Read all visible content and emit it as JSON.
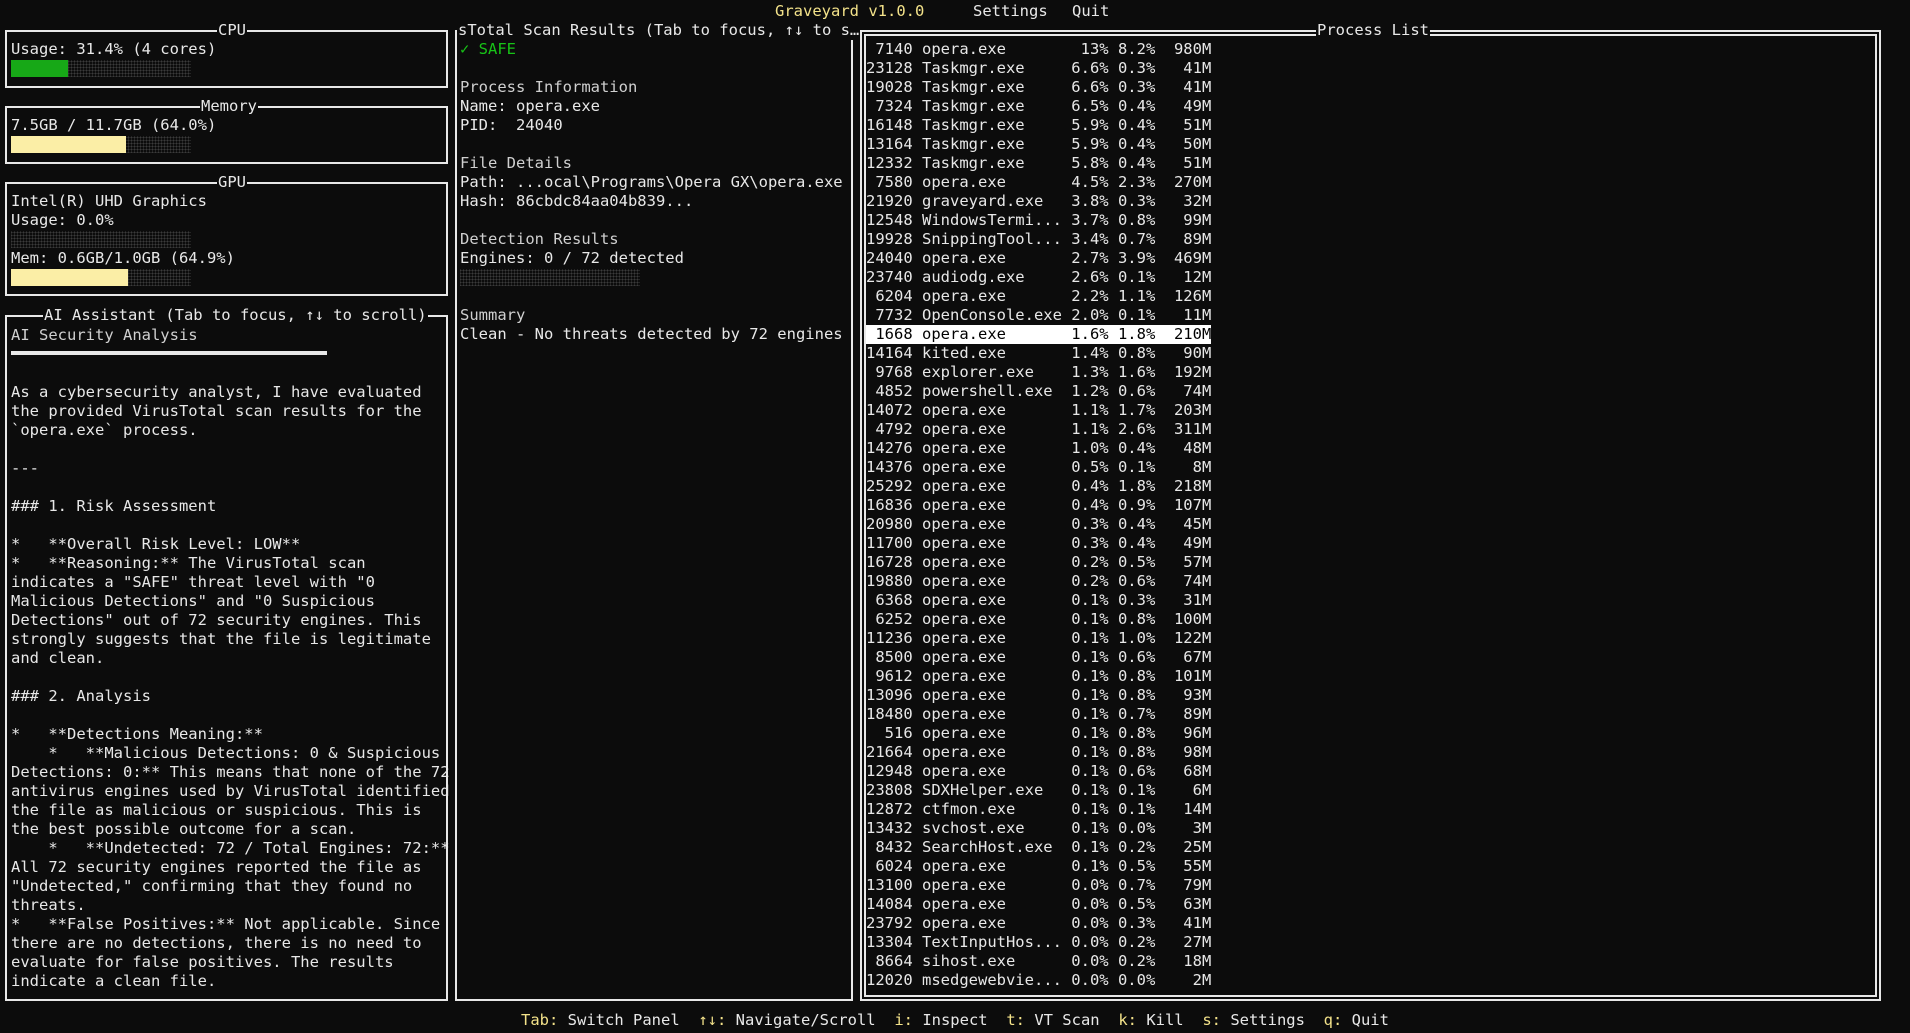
{
  "app": {
    "title": "Graveyard v1.0.0",
    "menu": [
      "Settings",
      "Quit"
    ]
  },
  "cpu": {
    "title": "CPU",
    "usage_text": "Usage: 31.4% (4 cores)",
    "usage_fraction": 0.314,
    "color": "#17a817"
  },
  "memory": {
    "title": "Memory",
    "usage_text": "7.5GB / 11.7GB (64.0%)",
    "usage_fraction": 0.64,
    "color": "#fbeea6"
  },
  "gpu": {
    "title": "GPU",
    "name": "Intel(R) UHD Graphics",
    "usage_text": "Usage: 0.0%",
    "usage_fraction": 0.0,
    "mem_text": "Mem: 0.6GB/1.0GB (64.9%)",
    "mem_fraction": 0.649,
    "usage_color": "#17a817",
    "mem_color": "#fbeea6"
  },
  "ai": {
    "title": "AI Assistant (Tab to focus, ↑↓ to scroll)",
    "heading": "AI Security Analysis",
    "lines": [
      "",
      "",
      "As a cybersecurity analyst, I have evaluated",
      "the provided VirusTotal scan results for the",
      "`opera.exe` process.",
      "",
      "---",
      "",
      "### 1. Risk Assessment",
      "",
      "*   **Overall Risk Level: LOW**",
      "*   **Reasoning:** The VirusTotal scan",
      "indicates a \"SAFE\" threat level with \"0",
      "Malicious Detections\" and \"0 Suspicious",
      "Detections\" out of 72 security engines. This",
      "strongly suggests that the file is legitimate",
      "and clean.",
      "",
      "### 2. Analysis",
      "",
      "*   **Detections Meaning:**",
      "    *   **Malicious Detections: 0 & Suspicious",
      "Detections: 0:** This means that none of the 72",
      "antivirus engines used by VirusTotal identified",
      "the file as malicious or suspicious. This is",
      "the best possible outcome for a scan.",
      "    *   **Undetected: 72 / Total Engines: 72:**",
      "All 72 security engines reported the file as",
      "\"Undetected,\" confirming that they found no",
      "threats.",
      "*   **False Positives:** Not applicable. Since",
      "there are no detections, there is no need to",
      "evaluate for false positives. The results",
      "indicate a clean file."
    ]
  },
  "vt": {
    "title": "sTotal Scan Results (Tab to focus, ↑↓ to s…",
    "status": "✓ SAFE",
    "status_color": "#17c317",
    "proc_info_label": "Process Information",
    "name_line": "Name: opera.exe",
    "pid_line": "PID:  24040",
    "file_details_label": "File Details",
    "path_line": "Path: ...ocal\\Programs\\Opera GX\\opera.exe",
    "hash_line": "Hash: 86cbdc84aa04b839...",
    "detection_label": "Detection Results",
    "engines_line": "Engines: 0 / 72 detected",
    "detection_fraction": 0.0,
    "summary_label": "Summary",
    "summary_text": "Clean - No threats detected by 72 engines"
  },
  "process_list": {
    "title": "Process List",
    "selected_index": 15,
    "rows": [
      [
        "7140",
        "opera.exe",
        "13%",
        "8.2%",
        "980M"
      ],
      [
        "23128",
        "Taskmgr.exe",
        "6.6%",
        "0.3%",
        "41M"
      ],
      [
        "19028",
        "Taskmgr.exe",
        "6.6%",
        "0.3%",
        "41M"
      ],
      [
        "7324",
        "Taskmgr.exe",
        "6.5%",
        "0.4%",
        "49M"
      ],
      [
        "16148",
        "Taskmgr.exe",
        "5.9%",
        "0.4%",
        "51M"
      ],
      [
        "13164",
        "Taskmgr.exe",
        "5.9%",
        "0.4%",
        "50M"
      ],
      [
        "12332",
        "Taskmgr.exe",
        "5.8%",
        "0.4%",
        "51M"
      ],
      [
        "7580",
        "opera.exe",
        "4.5%",
        "2.3%",
        "270M"
      ],
      [
        "21920",
        "graveyard.exe",
        "3.8%",
        "0.3%",
        "32M"
      ],
      [
        "12548",
        "WindowsTermi...",
        "3.7%",
        "0.8%",
        "99M"
      ],
      [
        "19928",
        "SnippingTool...",
        "3.4%",
        "0.7%",
        "89M"
      ],
      [
        "24040",
        "opera.exe",
        "2.7%",
        "3.9%",
        "469M"
      ],
      [
        "23740",
        "audiodg.exe",
        "2.6%",
        "0.1%",
        "12M"
      ],
      [
        "6204",
        "opera.exe",
        "2.2%",
        "1.1%",
        "126M"
      ],
      [
        "7732",
        "OpenConsole.exe",
        "2.0%",
        "0.1%",
        "11M"
      ],
      [
        "1668",
        "opera.exe",
        "1.6%",
        "1.8%",
        "210M"
      ],
      [
        "14164",
        "kited.exe",
        "1.4%",
        "0.8%",
        "90M"
      ],
      [
        "9768",
        "explorer.exe",
        "1.3%",
        "1.6%",
        "192M"
      ],
      [
        "4852",
        "powershell.exe",
        "1.2%",
        "0.6%",
        "74M"
      ],
      [
        "14072",
        "opera.exe",
        "1.1%",
        "1.7%",
        "203M"
      ],
      [
        "4792",
        "opera.exe",
        "1.1%",
        "2.6%",
        "311M"
      ],
      [
        "14276",
        "opera.exe",
        "1.0%",
        "0.4%",
        "48M"
      ],
      [
        "14376",
        "opera.exe",
        "0.5%",
        "0.1%",
        "8M"
      ],
      [
        "25292",
        "opera.exe",
        "0.4%",
        "1.8%",
        "218M"
      ],
      [
        "16836",
        "opera.exe",
        "0.4%",
        "0.9%",
        "107M"
      ],
      [
        "20980",
        "opera.exe",
        "0.3%",
        "0.4%",
        "45M"
      ],
      [
        "11700",
        "opera.exe",
        "0.3%",
        "0.4%",
        "49M"
      ],
      [
        "16728",
        "opera.exe",
        "0.2%",
        "0.5%",
        "57M"
      ],
      [
        "19880",
        "opera.exe",
        "0.2%",
        "0.6%",
        "74M"
      ],
      [
        "6368",
        "opera.exe",
        "0.1%",
        "0.3%",
        "31M"
      ],
      [
        "6252",
        "opera.exe",
        "0.1%",
        "0.8%",
        "100M"
      ],
      [
        "11236",
        "opera.exe",
        "0.1%",
        "1.0%",
        "122M"
      ],
      [
        "8500",
        "opera.exe",
        "0.1%",
        "0.6%",
        "67M"
      ],
      [
        "9612",
        "opera.exe",
        "0.1%",
        "0.8%",
        "101M"
      ],
      [
        "13096",
        "opera.exe",
        "0.1%",
        "0.8%",
        "93M"
      ],
      [
        "18480",
        "opera.exe",
        "0.1%",
        "0.7%",
        "89M"
      ],
      [
        "516",
        "opera.exe",
        "0.1%",
        "0.8%",
        "96M"
      ],
      [
        "21664",
        "opera.exe",
        "0.1%",
        "0.8%",
        "98M"
      ],
      [
        "12948",
        "opera.exe",
        "0.1%",
        "0.6%",
        "68M"
      ],
      [
        "23808",
        "SDXHelper.exe",
        "0.1%",
        "0.1%",
        "6M"
      ],
      [
        "12872",
        "ctfmon.exe",
        "0.1%",
        "0.1%",
        "14M"
      ],
      [
        "13432",
        "svchost.exe",
        "0.1%",
        "0.0%",
        "3M"
      ],
      [
        "8432",
        "SearchHost.exe",
        "0.1%",
        "0.2%",
        "25M"
      ],
      [
        "6024",
        "opera.exe",
        "0.1%",
        "0.5%",
        "55M"
      ],
      [
        "13100",
        "opera.exe",
        "0.0%",
        "0.7%",
        "79M"
      ],
      [
        "14084",
        "opera.exe",
        "0.0%",
        "0.5%",
        "63M"
      ],
      [
        "23792",
        "opera.exe",
        "0.0%",
        "0.3%",
        "41M"
      ],
      [
        "13304",
        "TextInputHos...",
        "0.0%",
        "0.2%",
        "27M"
      ],
      [
        "8664",
        "sihost.exe",
        "0.0%",
        "0.2%",
        "18M"
      ],
      [
        "12020",
        "msedgewebvie...",
        "0.0%",
        "0.0%",
        "2M"
      ]
    ]
  },
  "footer": {
    "items": [
      {
        "key": "Tab:",
        "label": "Switch Panel"
      },
      {
        "key": "↑↓:",
        "label": "Navigate/Scroll"
      },
      {
        "key": "i:",
        "label": "Inspect"
      },
      {
        "key": "t:",
        "label": "VT Scan"
      },
      {
        "key": "k:",
        "label": "Kill"
      },
      {
        "key": "s:",
        "label": "Settings"
      },
      {
        "key": "q:",
        "label": "Quit"
      }
    ]
  }
}
